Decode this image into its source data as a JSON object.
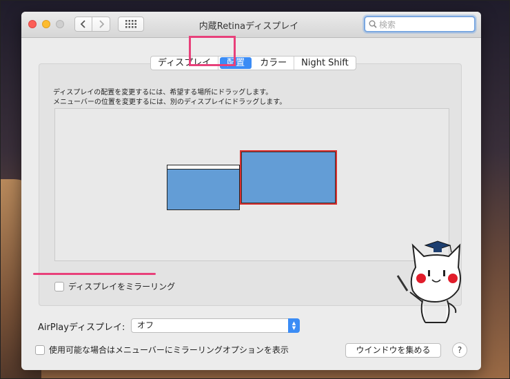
{
  "window": {
    "title": "内蔵Retinaディスプレイ",
    "search_placeholder": "検索"
  },
  "tabs": [
    {
      "label": "ディスプレイ",
      "active": false
    },
    {
      "label": "配置",
      "active": true
    },
    {
      "label": "カラー",
      "active": false
    },
    {
      "label": "Night Shift",
      "active": false
    }
  ],
  "arrangement": {
    "instruction_line1": "ディスプレイの配置を変更するには、希望する場所にドラッグします。",
    "instruction_line2": "メニューバーの位置を変更するには、別のディスプレイにドラッグします。",
    "mirror_label": "ディスプレイをミラーリング",
    "mirror_checked": false
  },
  "airplay": {
    "label": "AirPlayディスプレイ:",
    "value": "オフ"
  },
  "footer": {
    "menubar_option_label": "使用可能な場合はメニューバーにミラーリングオプションを表示",
    "menubar_option_checked": false,
    "gather_button": "ウインドウを集める",
    "help_button": "?"
  },
  "colors": {
    "accent": "#3b8cf5",
    "highlight": "#e8407a",
    "display_fill": "#639dd6",
    "selected_display_border": "#d93030"
  }
}
